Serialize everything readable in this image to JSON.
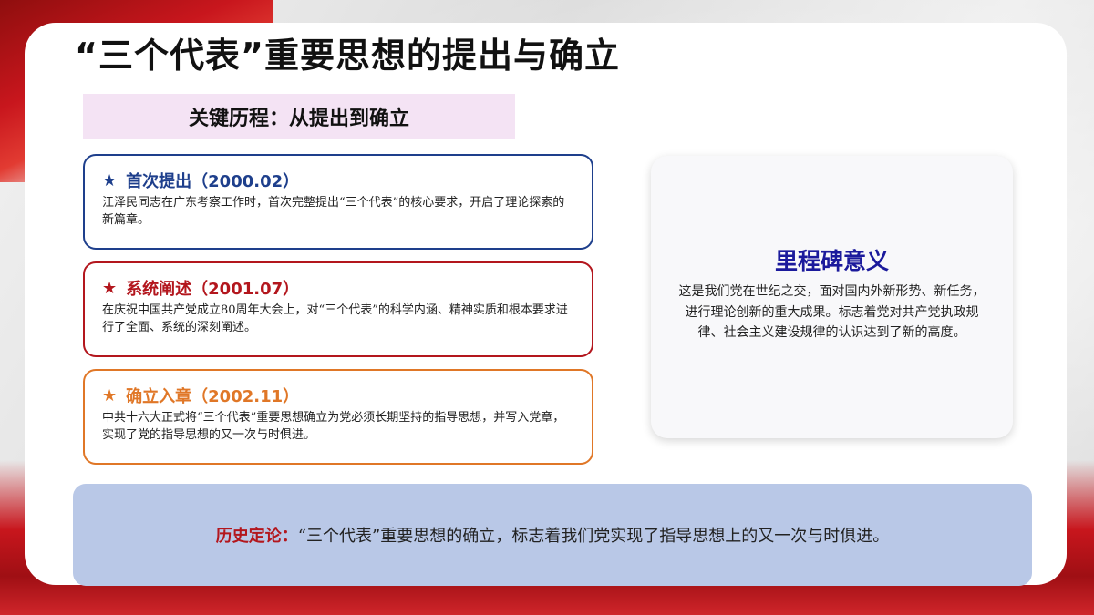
{
  "slide": {
    "title": "“三个代表”重要思想的提出与确立",
    "section_label": "关键历程：从提出到确立"
  },
  "milestones": [
    {
      "icon": "star-icon",
      "heading": "首次提出（2000.02）",
      "text": "江泽民同志在广东考察工作时，首次完整提出“三个代表”的核心要求，开启了理论探索的新篇章。"
    },
    {
      "icon": "star-icon",
      "heading": "系统阐述（2001.07）",
      "text": "在庆祝中国共产党成立80周年大会上，对“三个代表”的科学内涵、精神实质和根本要求进行了全面、系统的深刻阐述。"
    },
    {
      "icon": "star-icon",
      "heading": "确立入章（2002.11）",
      "text": "中共十六大正式将“三个代表”重要思想确立为党必须长期坚持的指导思想，并写入党章，实现了党的指导思想的又一次与时俱进。"
    }
  ],
  "significance": {
    "title": "里程碑意义",
    "text": "这是我们党在世纪之交，面对国内外新形势、新任务，进行理论创新的重大成果。标志着党对共产党执政规律、社会主义建设规律的认识达到了新的高度。"
  },
  "conclusion": {
    "label": "历史定论：",
    "text": "“三个代表”重要思想的确立，标志着我们党实现了指导思想上的又一次与时俱进。"
  },
  "colors": {
    "first": "#1e3f8c",
    "second": "#b3161d",
    "third": "#e07727",
    "significance_title": "#1b1a9c",
    "banner_bg": "#f4e3f4",
    "conclusion_bg": "#b9c8e7"
  }
}
